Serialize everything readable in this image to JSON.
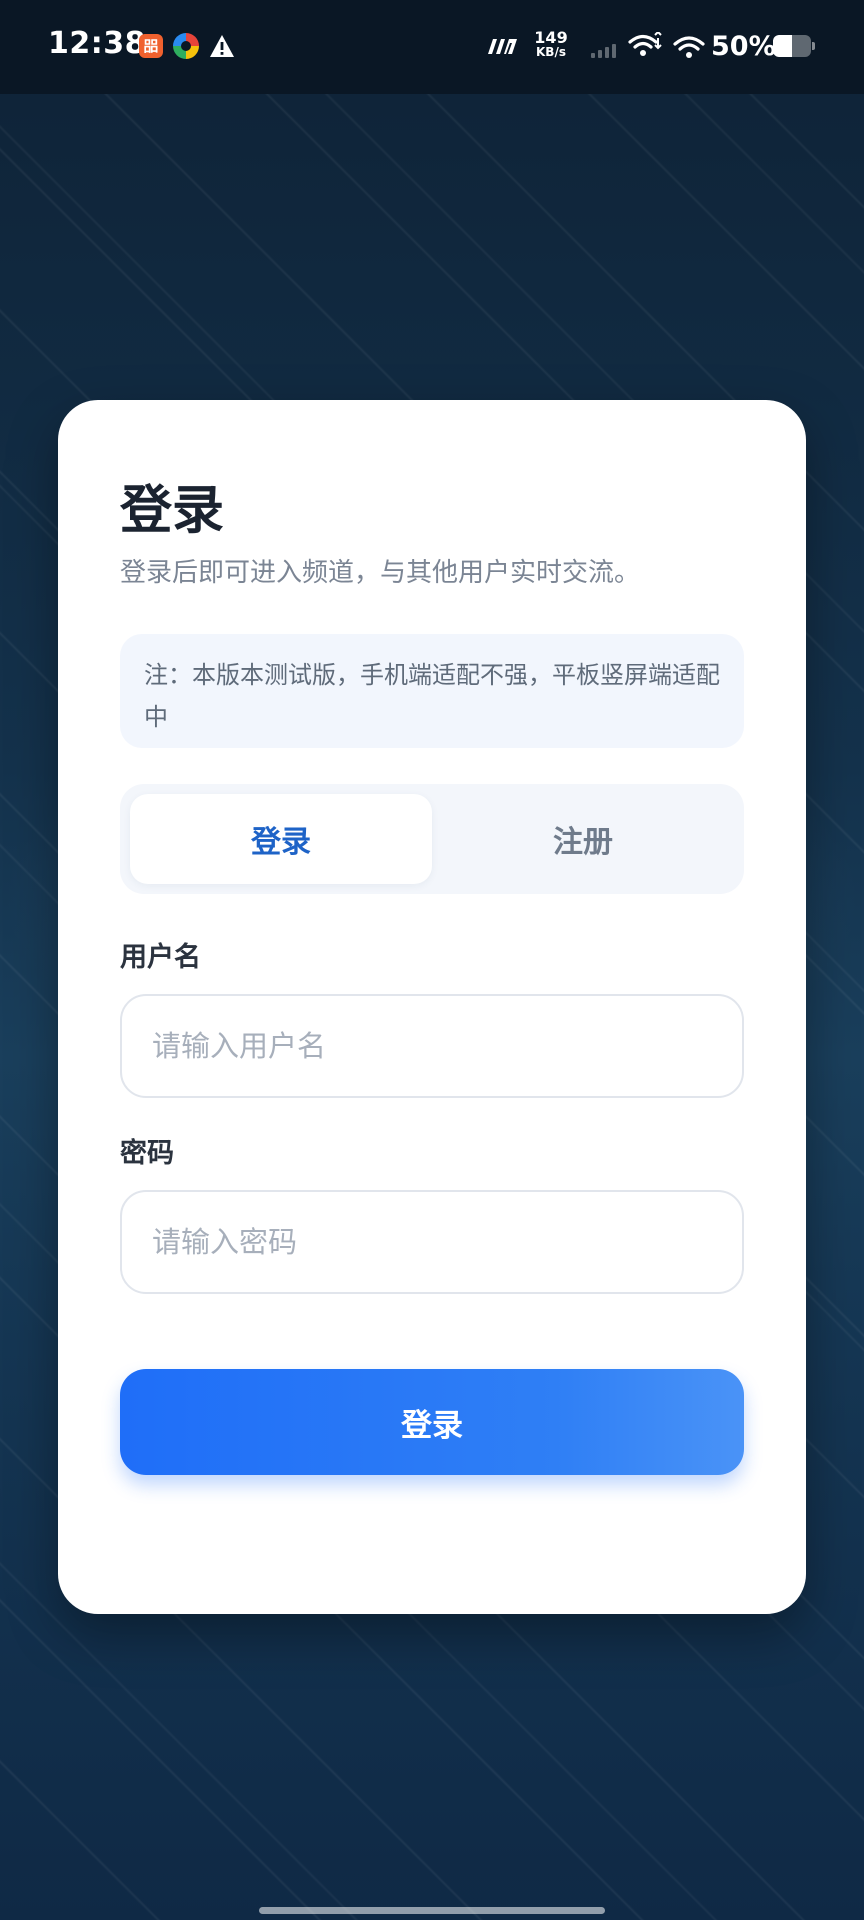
{
  "status_bar": {
    "time": "12:38",
    "app_icon_a_label": "㗊",
    "net_speed_value": "149",
    "net_speed_unit": "KB/s",
    "battery_percent_text": "50%",
    "battery_level": 0.5,
    "icons": [
      "app-icon",
      "multicolor-app-icon",
      "warning-icon",
      "speed-mode-icon",
      "signal-bars-icon",
      "wifi-icon",
      "wifi-icon",
      "battery-icon"
    ]
  },
  "login_card": {
    "title": "登录",
    "subtitle": "登录后即可进入频道，与其他用户实时交流。",
    "notice": "注：本版本测试版，手机端适配不强，平板竖屏端适配中",
    "tabs": [
      {
        "label": "登录",
        "active": true
      },
      {
        "label": "注册",
        "active": false
      }
    ],
    "username": {
      "label": "用户名",
      "placeholder": "请输入用户名",
      "value": ""
    },
    "password": {
      "label": "密码",
      "placeholder": "请输入密码",
      "value": ""
    },
    "submit_label": "登录"
  },
  "colors": {
    "primary": "#1f6ef8",
    "active_tab_text": "#1e63c7",
    "background_dark": "#0e2236"
  }
}
